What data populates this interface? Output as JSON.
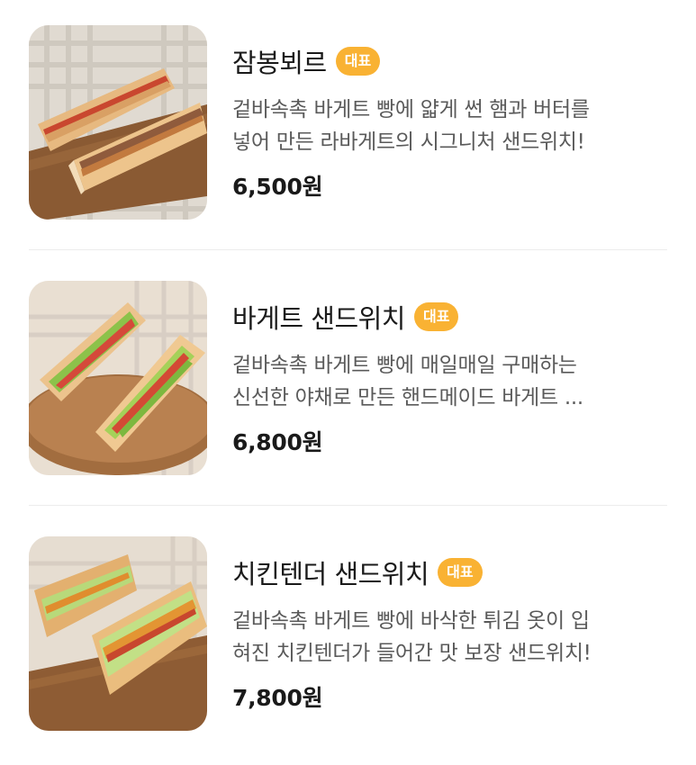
{
  "menu": {
    "items": [
      {
        "name": "잠봉뵈르",
        "badge": "대표",
        "desc_line1": "겉바속촉 바게트 빵에 얇게 썬 햄과 버터를",
        "desc_line2": "넣어 만든 라바게트의 시그니처 샌드위치!",
        "price": "6,500원"
      },
      {
        "name": "바게트 샌드위치",
        "badge": "대표",
        "desc_line1": "겉바속촉 바게트 빵에 매일매일 구매하는",
        "desc_line2": "신선한 야채로 만든 핸드메이드 바게트 ...",
        "price": "6,800원"
      },
      {
        "name": "치킨텐더 샌드위치",
        "badge": "대표",
        "desc_line1": "겉바속촉 바게트 빵에 바삭한 튀김 옷이 입",
        "desc_line2": "혀진 치킨텐더가 들어간 맛 보장 샌드위치!",
        "price": "7,800원"
      }
    ]
  },
  "colors": {
    "badge_bg": "#f9b233",
    "badge_text": "#ffffff",
    "divider": "#ececec"
  }
}
